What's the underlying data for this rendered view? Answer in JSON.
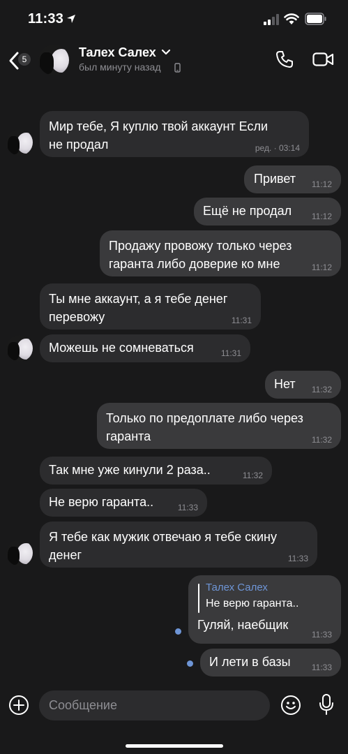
{
  "status_bar": {
    "time": "11:33"
  },
  "header": {
    "back_badge": "5",
    "contact_name": "Талех Салех",
    "last_seen": "был минуту назад"
  },
  "messages": [
    {
      "dir": "in",
      "text_lines": [
        "Мир тебе, Я куплю твой аккаунт  Если",
        "не продал"
      ],
      "time": "ред. · 03:14"
    },
    {
      "dir": "out",
      "text_lines": [
        "Привет"
      ],
      "time": "11:12"
    },
    {
      "dir": "out",
      "text_lines": [
        "Ещё не продал"
      ],
      "time": "11:12"
    },
    {
      "dir": "out",
      "text_lines": [
        "Продажу провожу только через",
        "гаранта либо доверие ко мне"
      ],
      "time": "11:12"
    },
    {
      "dir": "in",
      "text_lines": [
        "Ты мне аккаунт, а я тебе денег",
        "перевожу"
      ],
      "time": "11:31"
    },
    {
      "dir": "in",
      "text_lines": [
        "Можешь не сомневаться"
      ],
      "time": "11:31"
    },
    {
      "dir": "out",
      "text_lines": [
        "Нет"
      ],
      "time": "11:32"
    },
    {
      "dir": "out",
      "text_lines": [
        "Только по предоплате либо через",
        "гаранта"
      ],
      "time": "11:32"
    },
    {
      "dir": "in",
      "text_lines": [
        "Так мне уже кинули 2 раза.."
      ],
      "time": "11:32"
    },
    {
      "dir": "in",
      "text_lines": [
        "Не верю гаранта.."
      ],
      "time": "11:33"
    },
    {
      "dir": "in",
      "text_lines": [
        "Я тебе как мужик отвечаю я тебе скину",
        "денег"
      ],
      "time": "11:33"
    },
    {
      "dir": "out",
      "reply_name": "Талех Салех",
      "reply_text": "Не верю гаранта..",
      "text_lines": [
        "Гуляй, наебщик"
      ],
      "time": "11:33"
    },
    {
      "dir": "out",
      "text_lines": [
        "И лети в базы"
      ],
      "time": "11:33"
    }
  ],
  "composer": {
    "placeholder": "Сообщение"
  },
  "colors": {
    "background": "#19191a",
    "incoming": "#2c2c2e",
    "outgoing": "#3a3a3c",
    "accent": "#6e95d6",
    "muted": "#8e8e93"
  },
  "icons": [
    "location-arrow-icon",
    "signal-icon",
    "wifi-icon",
    "battery-icon",
    "back-chevron-icon",
    "chevron-down-icon",
    "phone-small-icon",
    "call-icon",
    "video-call-icon",
    "plus-icon",
    "emoji-icon",
    "microphone-icon"
  ]
}
